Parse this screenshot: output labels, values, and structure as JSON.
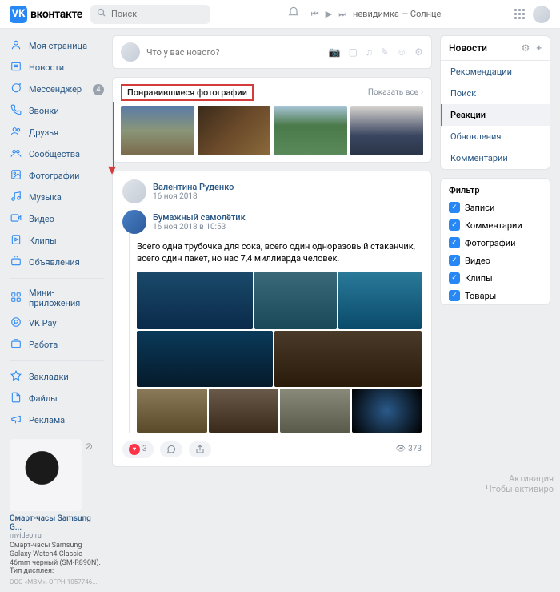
{
  "header": {
    "logo_text": "вконтакте",
    "logo_short": "VK",
    "search_placeholder": "Поиск",
    "player_track": "невидимка — Солнце"
  },
  "nav": {
    "items": [
      {
        "label": "Моя страница",
        "icon": "home"
      },
      {
        "label": "Новости",
        "icon": "news"
      },
      {
        "label": "Мессенджер",
        "icon": "chat",
        "badge": "4"
      },
      {
        "label": "Звонки",
        "icon": "phone"
      },
      {
        "label": "Друзья",
        "icon": "friends"
      },
      {
        "label": "Сообщества",
        "icon": "groups"
      },
      {
        "label": "Фотографии",
        "icon": "photo"
      },
      {
        "label": "Музыка",
        "icon": "music"
      },
      {
        "label": "Видео",
        "icon": "video"
      },
      {
        "label": "Клипы",
        "icon": "clips"
      },
      {
        "label": "Объявления",
        "icon": "market"
      }
    ],
    "items2": [
      {
        "label": "Мини-приложения",
        "icon": "apps"
      },
      {
        "label": "VK Pay",
        "icon": "pay"
      },
      {
        "label": "Работа",
        "icon": "work"
      }
    ],
    "items3": [
      {
        "label": "Закладки",
        "icon": "bookmark"
      },
      {
        "label": "Файлы",
        "icon": "files"
      },
      {
        "label": "Реклама",
        "icon": "ads"
      }
    ]
  },
  "ad": {
    "title": "Смарт-часы Samsung G...",
    "domain": "mvideo.ru",
    "desc": "Смарт-часы Samsung Galaxy Watch4 Classic 46mm черный (SM-R890N). Тип дисплея:",
    "footer": "ООО «МВМ». ОГРН 1057746..."
  },
  "composer": {
    "placeholder": "Что у вас нового?"
  },
  "liked": {
    "title": "Понравившиеся фотографии",
    "show_all": "Показать все"
  },
  "post": {
    "author": "Валентина Руденко",
    "date": "16 ноя 2018",
    "repost_author": "Бумажный самолётик",
    "repost_date": "16 ноя 2018 в 10:53",
    "text": "Всего одна трубочка для сока, всего один одноразовый стаканчик, всего один пакет, но нас 7,4 миллиарда человек.",
    "likes": "3",
    "views": "373"
  },
  "rsb": {
    "news_title": "Новости",
    "tabs": [
      "Рекомендации",
      "Поиск",
      "Реакции",
      "Обновления",
      "Комментарии"
    ],
    "active_tab": 2,
    "filter_title": "Фильтр",
    "filters": [
      "Записи",
      "Комментарии",
      "Фотографии",
      "Видео",
      "Клипы",
      "Товары"
    ]
  },
  "watermark": {
    "line1": "Активация",
    "line2": "Чтобы активиро"
  }
}
